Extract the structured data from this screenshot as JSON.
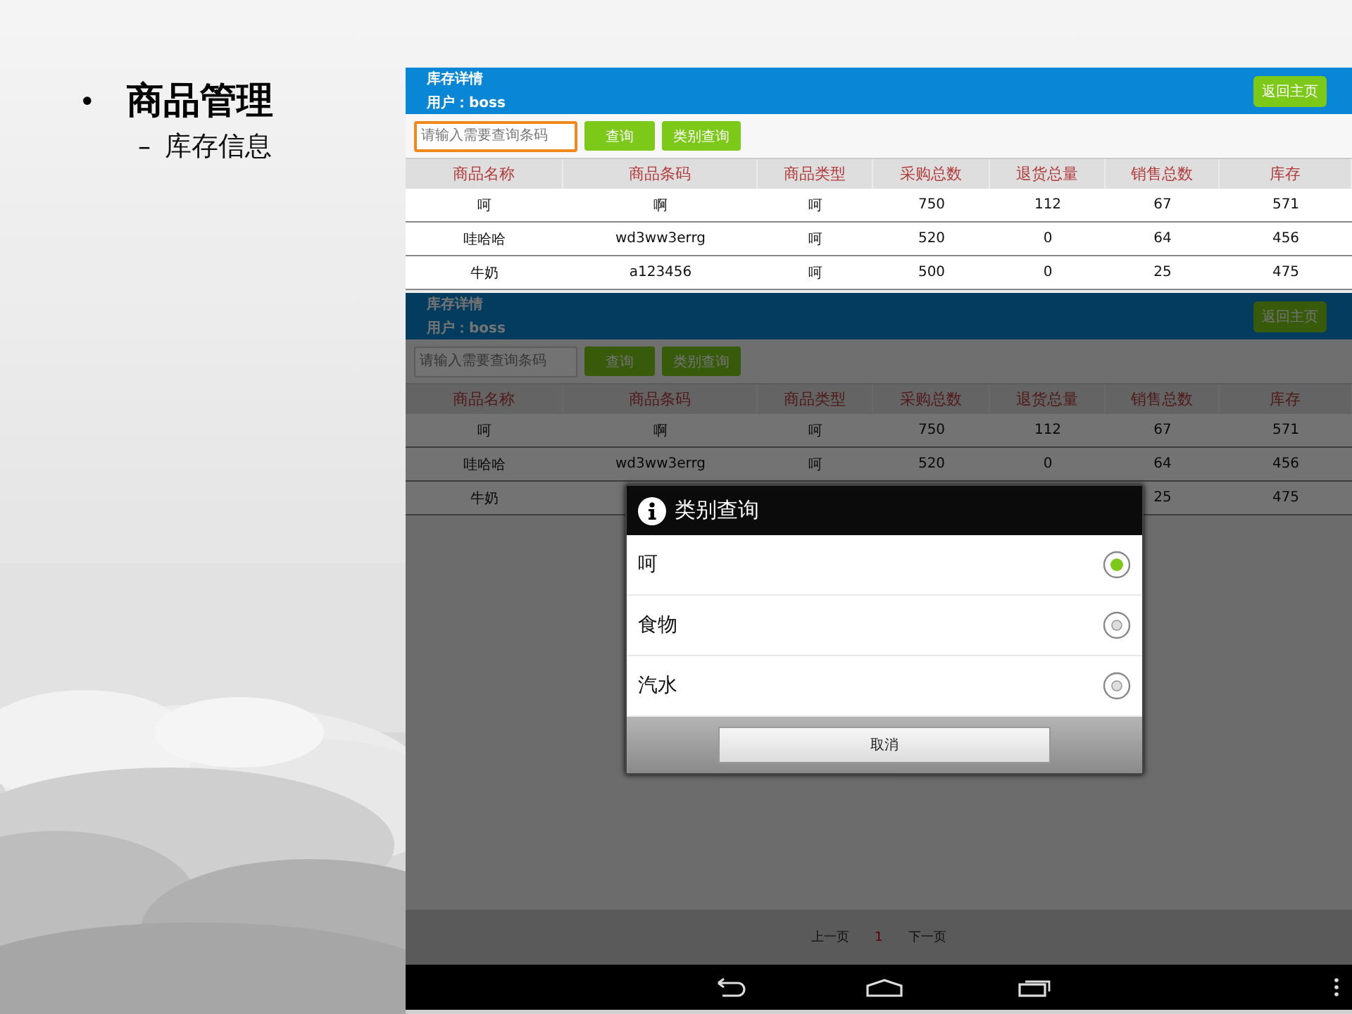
{
  "slide": {
    "bullet": "•",
    "title": "商品管理",
    "sub_dash": "–",
    "sub_title": "库存信息"
  },
  "screens": [
    {
      "dimmed": false,
      "header": {
        "title": "库存详情",
        "user": "用户：boss",
        "home_button": "返回主页"
      },
      "search": {
        "placeholder": "请输入需要查询条码",
        "focused": true
      },
      "buttons": [
        "查询",
        "类别查询"
      ],
      "columns": [
        "商品名称",
        "商品条码",
        "商品类型",
        "采购总数",
        "退货总量",
        "销售总数",
        "库存"
      ],
      "rows": [
        {
          "cells": [
            "呵",
            "啊",
            "呵",
            "750",
            "112",
            "67",
            "571"
          ]
        },
        {
          "cells": [
            "哇哈哈",
            "wd3ww3errg",
            "呵",
            "520",
            "0",
            "64",
            "456"
          ]
        },
        {
          "cells": [
            "牛奶",
            "a123456",
            "呵",
            "500",
            "0",
            "25",
            "475"
          ]
        }
      ]
    },
    {
      "dimmed": true,
      "header": {
        "title": "库存详情",
        "user": "用户：boss",
        "home_button": "返回主页"
      },
      "search": {
        "placeholder": "请输入需要查询条码",
        "focused": false
      },
      "buttons": [
        "查询",
        "类别查询"
      ],
      "columns": [
        "商品名称",
        "商品条码",
        "商品类型",
        "采购总数",
        "退货总量",
        "销售总数",
        "库存"
      ],
      "rows": [
        {
          "cells": [
            "呵",
            "啊",
            "呵",
            "750",
            "112",
            "67",
            "571"
          ]
        },
        {
          "cells": [
            "哇哈哈",
            "wd3ww3errg",
            "呵",
            "520",
            "0",
            "64",
            "456"
          ]
        },
        {
          "cells": [
            "牛奶",
            null,
            null,
            null,
            null,
            "25",
            "475"
          ]
        }
      ],
      "pagination": {
        "prev": "上一页",
        "page": "1",
        "next": "下一页"
      },
      "nav_bar": true,
      "dialog": {
        "title": "类别查询",
        "options": [
          {
            "label": "呵",
            "selected": true
          },
          {
            "label": "食物",
            "selected": false
          },
          {
            "label": "汽水",
            "selected": false
          }
        ],
        "cancel": "取消"
      }
    }
  ]
}
